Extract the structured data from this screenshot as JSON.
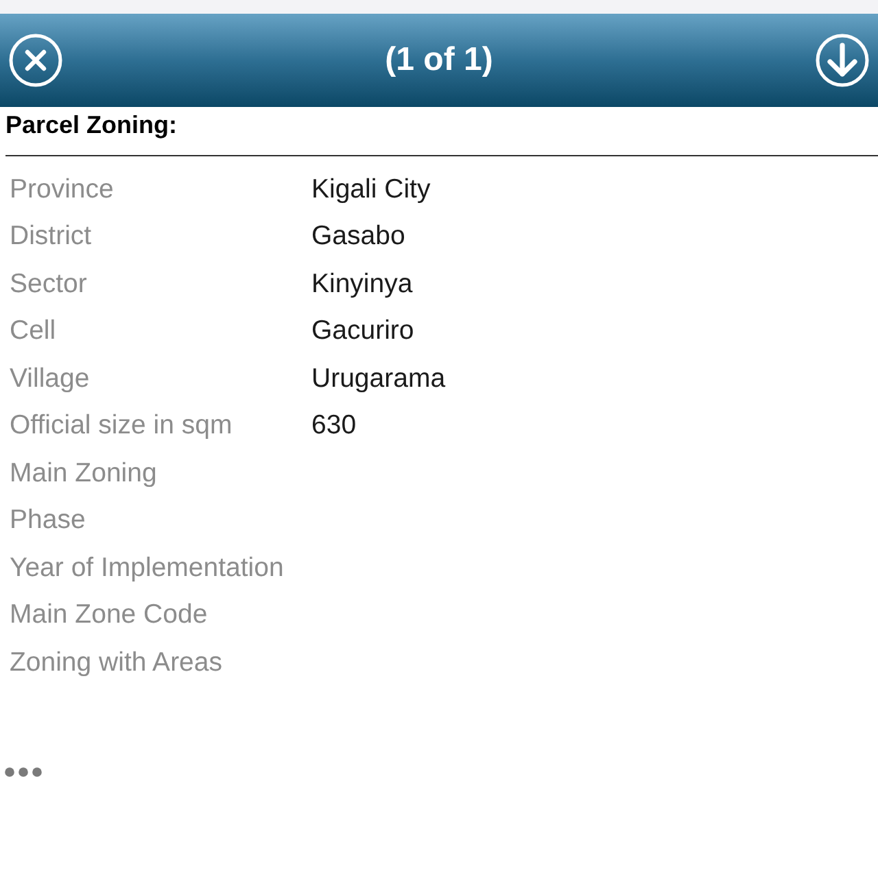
{
  "header": {
    "title": "(1 of 1)"
  },
  "section": {
    "title": "Parcel Zoning:"
  },
  "fields": [
    {
      "label": "Province",
      "value": "Kigali City"
    },
    {
      "label": "District",
      "value": "Gasabo"
    },
    {
      "label": "Sector",
      "value": "Kinyinya"
    },
    {
      "label": "Cell",
      "value": "Gacuriro"
    },
    {
      "label": "Village",
      "value": "Urugarama"
    },
    {
      "label": "Official size in sqm",
      "value": "630"
    },
    {
      "label": "Main Zoning"
    },
    {
      "label": "Phase"
    },
    {
      "label": "Year of Implementation"
    },
    {
      "label": "Main Zone Code"
    },
    {
      "label": "Zoning with Areas"
    }
  ]
}
